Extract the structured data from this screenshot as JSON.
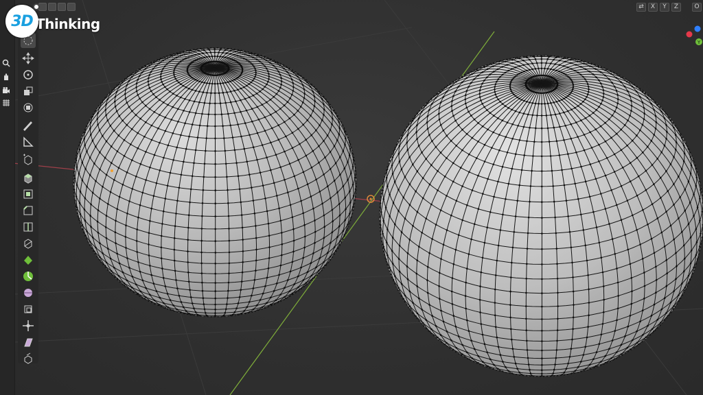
{
  "logo": {
    "mark": "3D",
    "text": "Thinking"
  },
  "header": {
    "axis_toggles": [
      "X",
      "Y",
      "Z"
    ],
    "options_label": "O"
  },
  "gizmo": {
    "axes": [
      {
        "name": "Z",
        "color": "#2f80ff"
      },
      {
        "name": "Y",
        "color": "#6fbf3a"
      },
      {
        "name": "X",
        "color": "#e5394a"
      }
    ]
  },
  "toolbar": {
    "tools": [
      "select-icon",
      "move-icon",
      "rotate-icon",
      "scale-icon",
      "transform-icon",
      "annotate-icon",
      "measure-icon",
      "add-cube-icon",
      "extrude-icon",
      "inset-icon",
      "bevel-icon",
      "loop-cut-icon",
      "knife-icon",
      "poly-build-icon",
      "spin-icon",
      "smooth-icon",
      "edge-slide-icon",
      "shrink-fatten-icon",
      "shear-icon",
      "rip-icon"
    ],
    "active_tool": "select-icon"
  },
  "nav": [
    "zoom-icon",
    "pan-icon",
    "camera-icon",
    "grid-icon"
  ],
  "colors": {
    "viewport_bg": "#2f2f2f",
    "mesh_face": "#b9b9b9",
    "mesh_wire": "#111111",
    "x_axis": "#c0404a",
    "y_axis": "#7fae3a",
    "origin": "#f0a030"
  }
}
